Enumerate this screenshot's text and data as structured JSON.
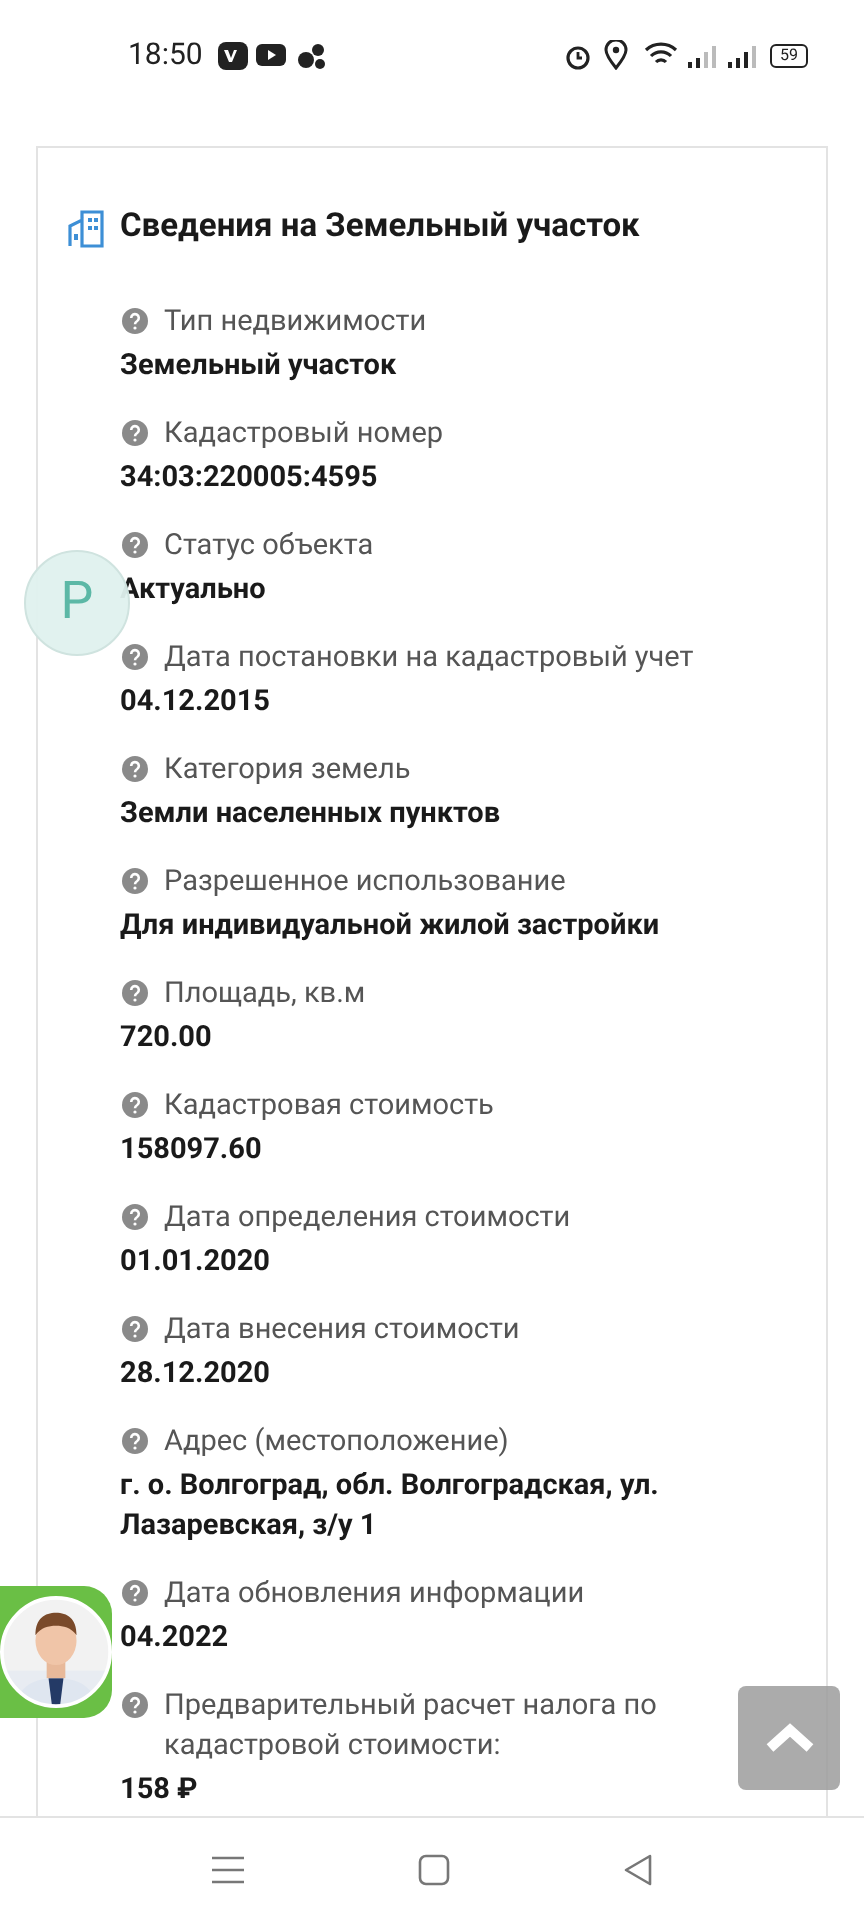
{
  "status_bar": {
    "time": "18:50",
    "battery": "59"
  },
  "section": {
    "title": "Сведения на Земельный участок",
    "fields": [
      {
        "label": "Тип недвижимости",
        "value": "Земельный участок"
      },
      {
        "label": "Кадастровый номер",
        "value": "34:03:220005:4595"
      },
      {
        "label": "Статус объекта",
        "value": "Актуально"
      },
      {
        "label": "Дата постановки на кадастровый учет",
        "value": "04.12.2015"
      },
      {
        "label": "Категория земель",
        "value": "Земли населенных пунктов"
      },
      {
        "label": "Разрешенное использование",
        "value": "Для индивидуальной жилой застройки"
      },
      {
        "label": "Площадь, кв.м",
        "value": "720.00"
      },
      {
        "label": "Кадастровая стоимость",
        "value": "158097.60"
      },
      {
        "label": "Дата определения стоимости",
        "value": "01.01.2020"
      },
      {
        "label": "Дата внесения стоимости",
        "value": "28.12.2020"
      },
      {
        "label": "Адрес (местоположение)",
        "value": "г. о. Волгоград, обл. Волгоградская, ул. Лазаревская, з/у 1"
      },
      {
        "label": "Дата обновления информации",
        "value": "04.2022"
      },
      {
        "label": "Предварительный расчет налога по кадастровой стоимости:",
        "value": "158 ₽"
      }
    ]
  },
  "contact_bubble": {
    "letter": "P"
  }
}
